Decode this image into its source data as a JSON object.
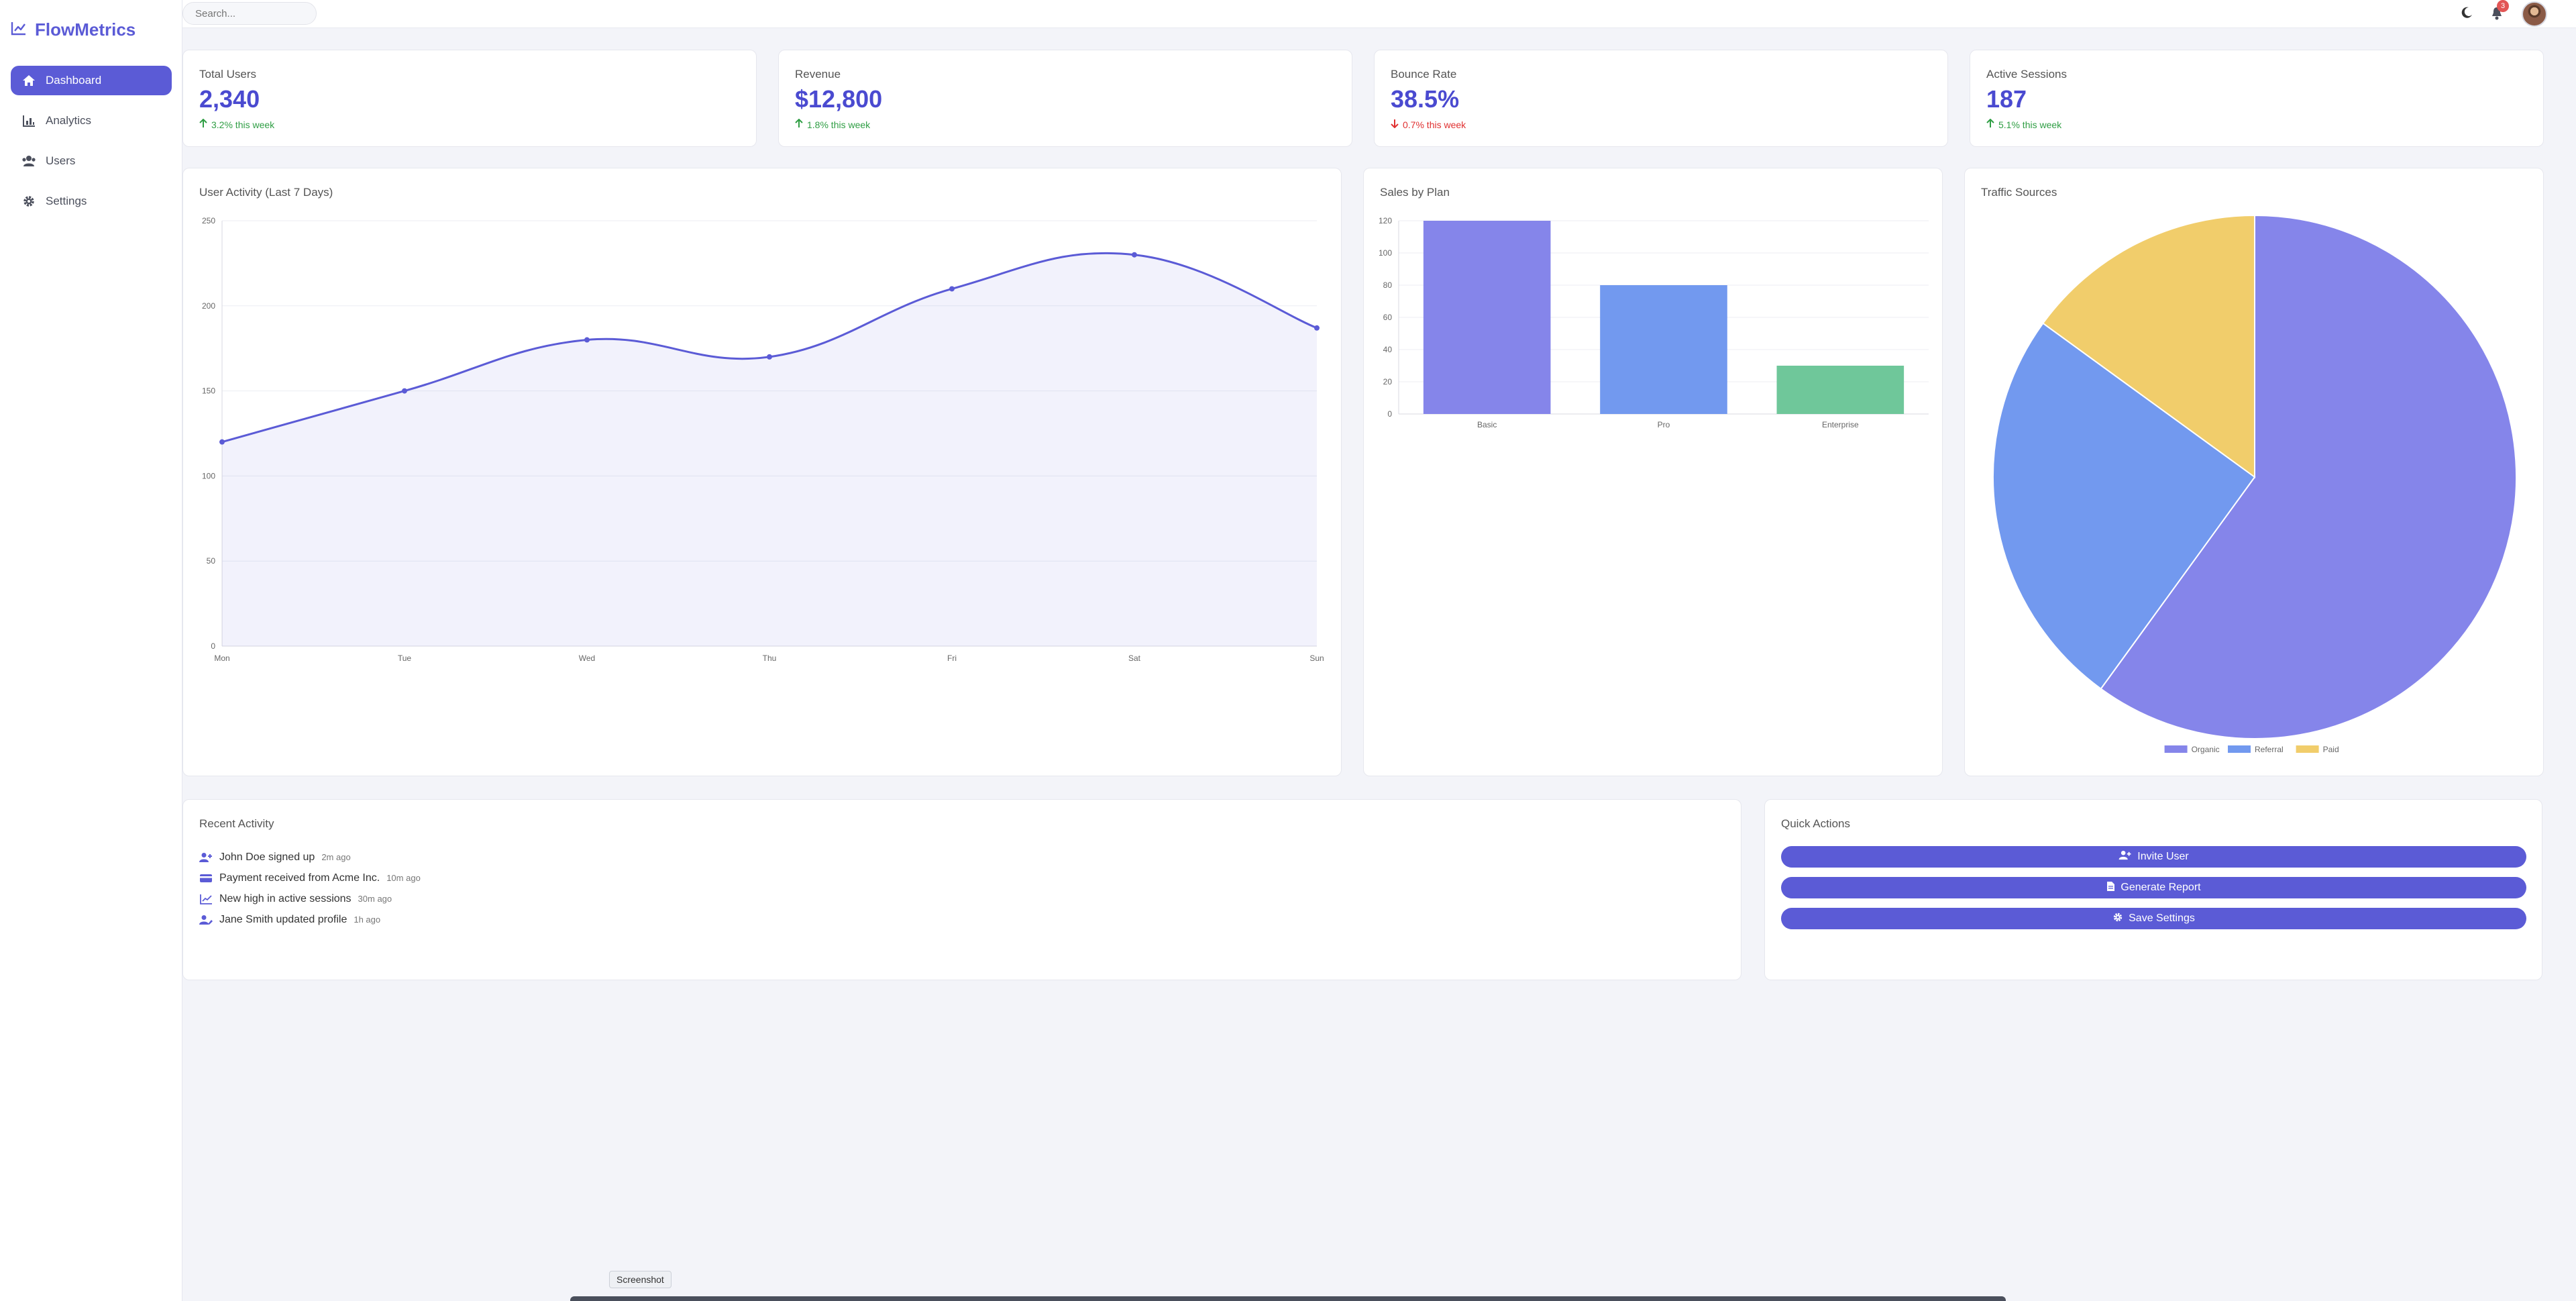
{
  "app": {
    "brand": "FlowMetrics"
  },
  "sidebar": {
    "items": [
      {
        "label": "Dashboard",
        "icon": "home-icon",
        "active": true
      },
      {
        "label": "Analytics",
        "icon": "bar-chart-icon",
        "active": false
      },
      {
        "label": "Users",
        "icon": "users-icon",
        "active": false
      },
      {
        "label": "Settings",
        "icon": "gear-icon",
        "active": false
      }
    ]
  },
  "header": {
    "search_placeholder": "Search...",
    "notification_count": "3"
  },
  "stats": [
    {
      "label": "Total Users",
      "value": "2,340",
      "change": "3.2% this week",
      "direction": "up"
    },
    {
      "label": "Revenue",
      "value": "$12,800",
      "change": "1.8% this week",
      "direction": "up"
    },
    {
      "label": "Bounce Rate",
      "value": "38.5%",
      "change": "0.7% this week",
      "direction": "down"
    },
    {
      "label": "Active Sessions",
      "value": "187",
      "change": "5.1% this week",
      "direction": "up"
    }
  ],
  "chart_data": [
    {
      "type": "line",
      "title": "User Activity (Last 7 Days)",
      "categories": [
        "Mon",
        "Tue",
        "Wed",
        "Thu",
        "Fri",
        "Sat",
        "Sun"
      ],
      "values": [
        120,
        150,
        180,
        170,
        210,
        230,
        187
      ],
      "ylim": [
        0,
        250
      ],
      "yticks": [
        0,
        50,
        100,
        150,
        200,
        250
      ],
      "grid": true,
      "color": "#5b5bd6"
    },
    {
      "type": "bar",
      "title": "Sales by Plan",
      "categories": [
        "Basic",
        "Pro",
        "Enterprise"
      ],
      "values": [
        120,
        80,
        30
      ],
      "ylim": [
        0,
        120
      ],
      "yticks": [
        0,
        20,
        40,
        60,
        80,
        100,
        120
      ],
      "colors": [
        "#8585ea",
        "#7299ef",
        "#6fc79a"
      ]
    },
    {
      "type": "pie",
      "title": "Traffic Sources",
      "categories": [
        "Organic",
        "Referral",
        "Paid"
      ],
      "values": [
        60,
        25,
        15
      ],
      "colors": [
        "#8585ea",
        "#7299ef",
        "#f1cd6b"
      ],
      "legend": "bottom"
    }
  ],
  "recent_activity": {
    "title": "Recent Activity",
    "items": [
      {
        "text": "John Doe signed up",
        "time": "2m ago",
        "icon": "user-plus-icon"
      },
      {
        "text": "Payment received from Acme Inc.",
        "time": "10m ago",
        "icon": "credit-card-icon"
      },
      {
        "text": "New high in active sessions",
        "time": "30m ago",
        "icon": "line-chart-icon"
      },
      {
        "text": "Jane Smith updated profile",
        "time": "1h ago",
        "icon": "user-edit-icon"
      }
    ]
  },
  "quick_actions": {
    "title": "Quick Actions",
    "buttons": [
      {
        "label": "Invite User",
        "icon": "user-plus-icon"
      },
      {
        "label": "Generate Report",
        "icon": "file-icon"
      },
      {
        "label": "Save Settings",
        "icon": "gear-icon"
      }
    ]
  },
  "overlay": {
    "tooltip": "Screenshot"
  },
  "colors": {
    "accent": "#5b5bd6",
    "up": "#2f9e44",
    "down": "#e03131"
  }
}
